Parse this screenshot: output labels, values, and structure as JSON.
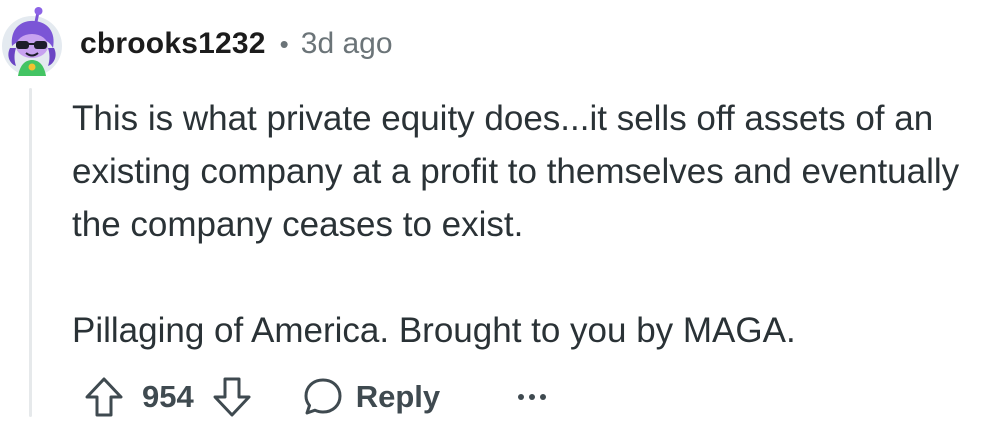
{
  "comment": {
    "author": "cbrooks1232",
    "separator": "•",
    "timestamp": "3d ago",
    "paragraphs": [
      "This is what private equity does...it sells off assets of an existing company at a profit to themselves and eventually the company ceases to exist.",
      "Pillaging of America. Brought to you by MAGA."
    ],
    "score": "954",
    "reply_label": "Reply"
  },
  "icons": {
    "avatar": "avatar-icon",
    "upvote": "upvote-arrow-icon",
    "downvote": "downvote-arrow-icon",
    "reply": "speech-bubble-icon",
    "more": "ellipsis-icon"
  },
  "colors": {
    "author": "#1c1c1c",
    "meta_gray": "#6b7478",
    "body_text": "#2a3236",
    "action_gray": "#3f4a50",
    "thread_line": "#e6e9eb",
    "avatar_bg": "#e4eaf0",
    "avatar_hair": "#7b55d6"
  }
}
